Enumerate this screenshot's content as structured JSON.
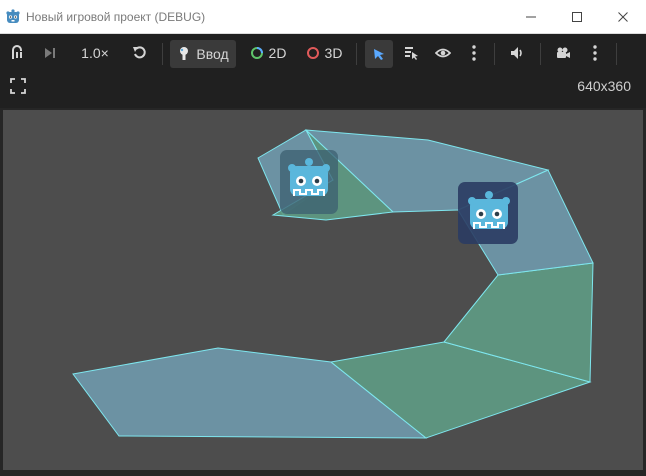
{
  "window": {
    "title": "Новый игровой проект (DEBUG)",
    "app_icon": "godot-icon",
    "controls": [
      "minimize-icon",
      "maximize-icon",
      "close-icon"
    ]
  },
  "toolbar": {
    "zoom_label": "1.0×",
    "input_label": "Ввод",
    "mode_2d_label": "2D",
    "mode_3d_label": "3D",
    "resolution": "640x360",
    "colors": {
      "mode_2d_ring": "#5fc46a",
      "mode_3d_ring": "#e05a5a",
      "select_arrow": "#5aa9ff"
    }
  },
  "viewport": {
    "canvas_color": "#4d4d4d",
    "polygon_outline": "#7ee6ee",
    "sprites": [
      "godot-logo-sprite",
      "godot-logo-sprite"
    ]
  }
}
